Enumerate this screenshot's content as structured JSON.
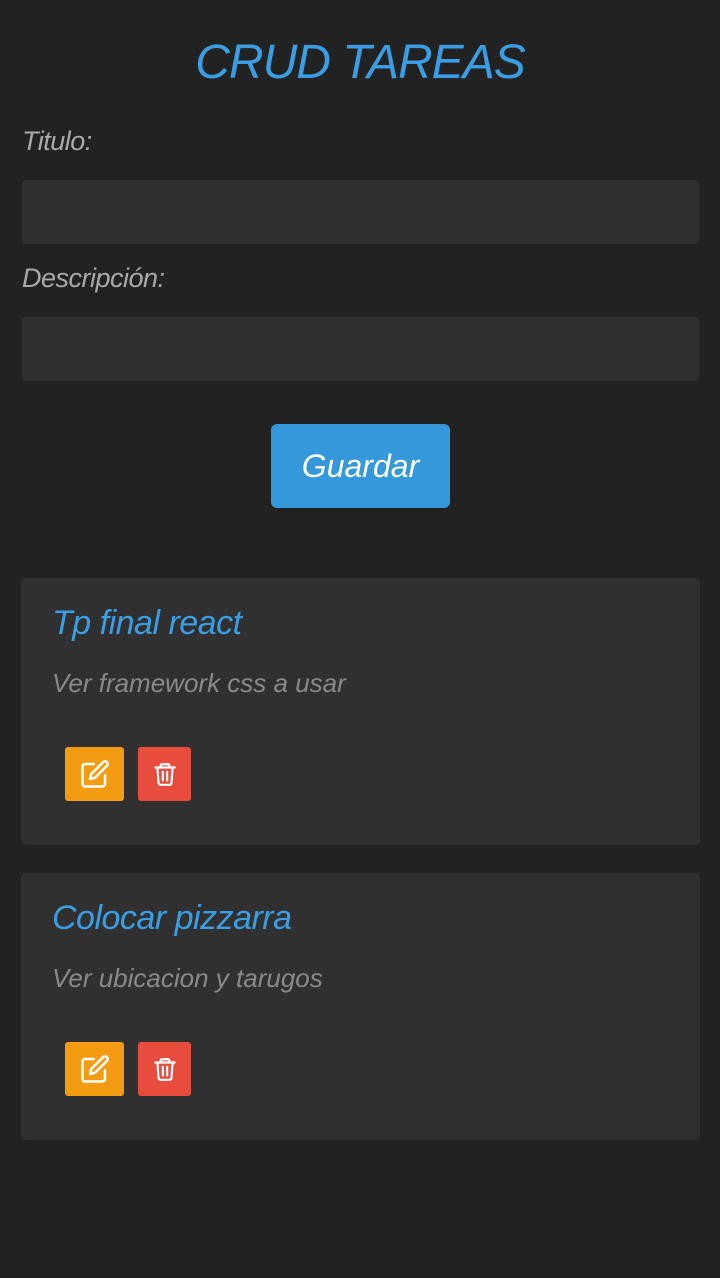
{
  "header": {
    "title": "CRUD TAREAS"
  },
  "form": {
    "titulo_label": "Titulo:",
    "titulo_value": "",
    "descripcion_label": "Descripción:",
    "descripcion_value": "",
    "save_label": "Guardar"
  },
  "tasks": [
    {
      "title": "Tp final react",
      "description": "Ver framework css a usar",
      "edit_icon": "edit-icon",
      "delete_icon": "trash-icon"
    },
    {
      "title": "Colocar pizzarra",
      "description": "Ver ubicacion y tarugos",
      "edit_icon": "edit-icon",
      "delete_icon": "trash-icon"
    }
  ],
  "colors": {
    "background": "#222222",
    "accent": "#3498db",
    "edit": "#f39c12",
    "delete": "#e74c3c"
  }
}
